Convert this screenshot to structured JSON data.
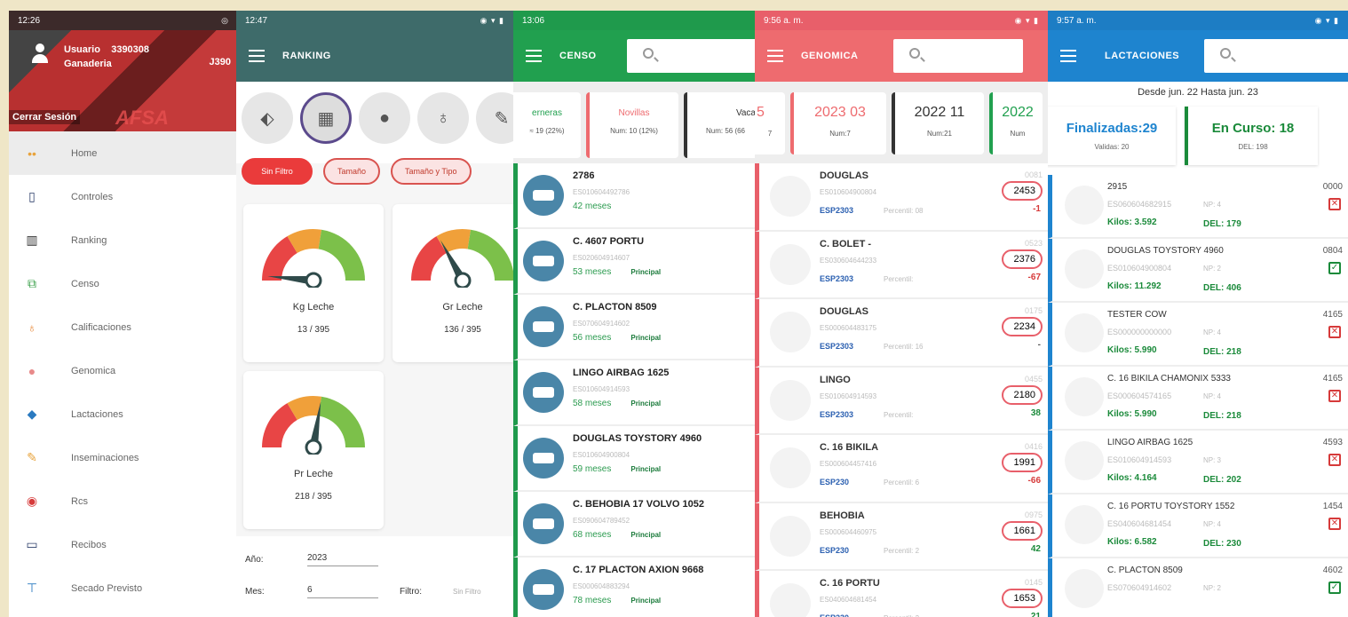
{
  "drawer": {
    "status_time": "12:26",
    "user_line": "Usuario",
    "user_value": "3390308",
    "farm_line": "Ganaderia",
    "farm_value": "J390",
    "logout": "Cerrar Sesión",
    "brand": "AFSA",
    "items": [
      {
        "label": "Home",
        "icon": "home-icon"
      },
      {
        "label": "Controles",
        "icon": "phone-icon"
      },
      {
        "label": "Ranking",
        "icon": "bar-chart-icon"
      },
      {
        "label": "Censo",
        "icon": "clipboard-icon"
      },
      {
        "label": "Calificaciones",
        "icon": "medal-icon"
      },
      {
        "label": "Genomica",
        "icon": "dna-icon"
      },
      {
        "label": "Lactaciones",
        "icon": "tag-icon"
      },
      {
        "label": "Inseminaciones",
        "icon": "syringe-icon"
      },
      {
        "label": "Rcs",
        "icon": "target-icon"
      },
      {
        "label": "Recibos",
        "icon": "card-icon"
      },
      {
        "label": "Secado Previsto",
        "icon": "pin-icon"
      }
    ]
  },
  "ranking": {
    "status_time": "12:47",
    "title": "RANKING",
    "chips": [
      "Sin Filtro",
      "Tamaño",
      "Tamaño y Tipo"
    ],
    "gauges": [
      {
        "name": "Kg Leche",
        "value": "13 / 395",
        "fraction": 0.03
      },
      {
        "name": "Gr Leche",
        "value": "136 / 395",
        "fraction": 0.34
      },
      {
        "name": "Pr Leche",
        "value": "218 / 395",
        "fraction": 0.55
      }
    ],
    "filters": {
      "year_label": "Año:",
      "year_value": "2023",
      "month_label": "Mes:",
      "month_value": "6",
      "filter_label": "Filtro:",
      "filter_value": "Sin Filtro"
    }
  },
  "censo": {
    "status_time": "13:06",
    "title": "CENSO",
    "tabs": [
      {
        "label": "erneras",
        "sub": "≈ 19 (22%)",
        "color": "#21a04f"
      },
      {
        "label": "Novillas",
        "sub": "Num: 10 (12%)",
        "color": "#ee6b6f"
      },
      {
        "label": "Vacas",
        "sub": "Num: 56 (66",
        "color": "#333333"
      }
    ],
    "rows": [
      {
        "name": "2786",
        "code": "ES010604492786",
        "age": "42 meses",
        "tag": ""
      },
      {
        "name": "C. 4607 PORTU",
        "code": "ES020604914607",
        "age": "53 meses",
        "tag": "Principal"
      },
      {
        "name": "C. PLACTON 8509",
        "code": "ES070604914602",
        "age": "56 meses",
        "tag": "Principal"
      },
      {
        "name": "LINGO AIRBAG 1625",
        "code": "ES010604914593",
        "age": "58 meses",
        "tag": "Principal"
      },
      {
        "name": "DOUGLAS TOYSTORY 4960",
        "code": "ES010604900804",
        "age": "59 meses",
        "tag": "Principal"
      },
      {
        "name": "C. BEHOBIA 17 VOLVO 1052",
        "code": "ES090604789452",
        "age": "68 meses",
        "tag": "Principal"
      },
      {
        "name": "C. 17 PLACTON AXION 9668",
        "code": "ES000604883294",
        "age": "78 meses",
        "tag": "Principal"
      }
    ]
  },
  "genomica": {
    "status_time": "9:56 a. m.",
    "title": "GENOMICA",
    "tabs": [
      {
        "label": "5",
        "sub": "7",
        "color": "#ee6b6f"
      },
      {
        "label": "2023 03",
        "sub": "Num:7",
        "color": "#ee6b6f"
      },
      {
        "label": "2022 11",
        "sub": "Num:21",
        "color": "#333333"
      },
      {
        "label": "2022",
        "sub": "Num",
        "color": "#21a04f"
      }
    ],
    "rows": [
      {
        "name": "DOUGLAS",
        "code": "ES010604900804",
        "tag": "ESP2303",
        "perc": "Percentil: 08",
        "id": "0081",
        "score": "2453",
        "delta": "-1",
        "dcolor": "#d63a3a"
      },
      {
        "name": "C. BOLET -",
        "code": "ES030604644233",
        "tag": "ESP2303",
        "perc": "Percentil:",
        "id": "0523",
        "score": "2376",
        "delta": "-67",
        "dcolor": "#d63a3a"
      },
      {
        "name": "DOUGLAS",
        "code": "ES000604483175",
        "tag": "ESP2303",
        "perc": "Percentil: 16",
        "id": "0175",
        "score": "2234",
        "delta": "-",
        "dcolor": "#555555"
      },
      {
        "name": "LINGO",
        "code": "ES010604914593",
        "tag": "ESP2303",
        "perc": "Percentil:",
        "id": "0455",
        "score": "2180",
        "delta": "38",
        "dcolor": "#1a8a3a"
      },
      {
        "name": "C. 16 BIKILA",
        "code": "ES000604457416",
        "tag": "ESP230",
        "perc": "Percentil: 6",
        "id": "0416",
        "score": "1991",
        "delta": "-66",
        "dcolor": "#d63a3a"
      },
      {
        "name": "BEHOBIA",
        "code": "ES000604460975",
        "tag": "ESP230",
        "perc": "Percentil: 2",
        "id": "0975",
        "score": "1661",
        "delta": "42",
        "dcolor": "#1a8a3a"
      },
      {
        "name": "C. 16 PORTU",
        "code": "ES040604681454",
        "tag": "ESP230",
        "perc": "Percentil: 2",
        "id": "0145",
        "score": "1653",
        "delta": "21",
        "dcolor": "#1a8a3a"
      }
    ]
  },
  "lactaciones": {
    "status_time": "9:57 a. m.",
    "title": "LACTACIONES",
    "range": "Desde jun. 22  Hasta jun. 23",
    "cards": [
      {
        "label": "Finalizadas:29",
        "sub": "Validas: 20",
        "color": "#1e84cf"
      },
      {
        "label": "En Curso: 18",
        "sub": "DEL: 198",
        "color": "#1a8a3a"
      }
    ],
    "rows": [
      {
        "name": "2915",
        "code": "ES060604682915",
        "np": "NP: 4",
        "kg": "Kilos: 3.592",
        "del": "DEL: 179",
        "id": "0000",
        "status": "x"
      },
      {
        "name": "DOUGLAS TOYSTORY 4960",
        "code": "ES010604900804",
        "np": "NP: 2",
        "kg": "Kilos: 11.292",
        "del": "DEL: 406",
        "id": "0804",
        "status": "check"
      },
      {
        "name": "TESTER COW",
        "code": "ES000000000000",
        "np": "NP: 4",
        "kg": "Kilos: 5.990",
        "del": "DEL: 218",
        "id": "4165",
        "status": "x"
      },
      {
        "name": "C. 16 BIKILA CHAMONIX 5333",
        "code": "ES000604574165",
        "np": "NP: 4",
        "kg": "Kilos: 5.990",
        "del": "DEL: 218",
        "id": "4165",
        "status": "x"
      },
      {
        "name": "LINGO AIRBAG 1625",
        "code": "ES010604914593",
        "np": "NP: 3",
        "kg": "Kilos: 4.164",
        "del": "DEL: 202",
        "id": "4593",
        "status": "x"
      },
      {
        "name": "C. 16 PORTU TOYSTORY 1552",
        "code": "ES040604681454",
        "np": "NP: 4",
        "kg": "Kilos: 6.582",
        "del": "DEL: 230",
        "id": "1454",
        "status": "x"
      },
      {
        "name": "C. PLACTON 8509",
        "code": "ES070604914602",
        "np": "NP: 2",
        "kg": "",
        "del": "",
        "id": "4602",
        "status": "check"
      }
    ]
  }
}
